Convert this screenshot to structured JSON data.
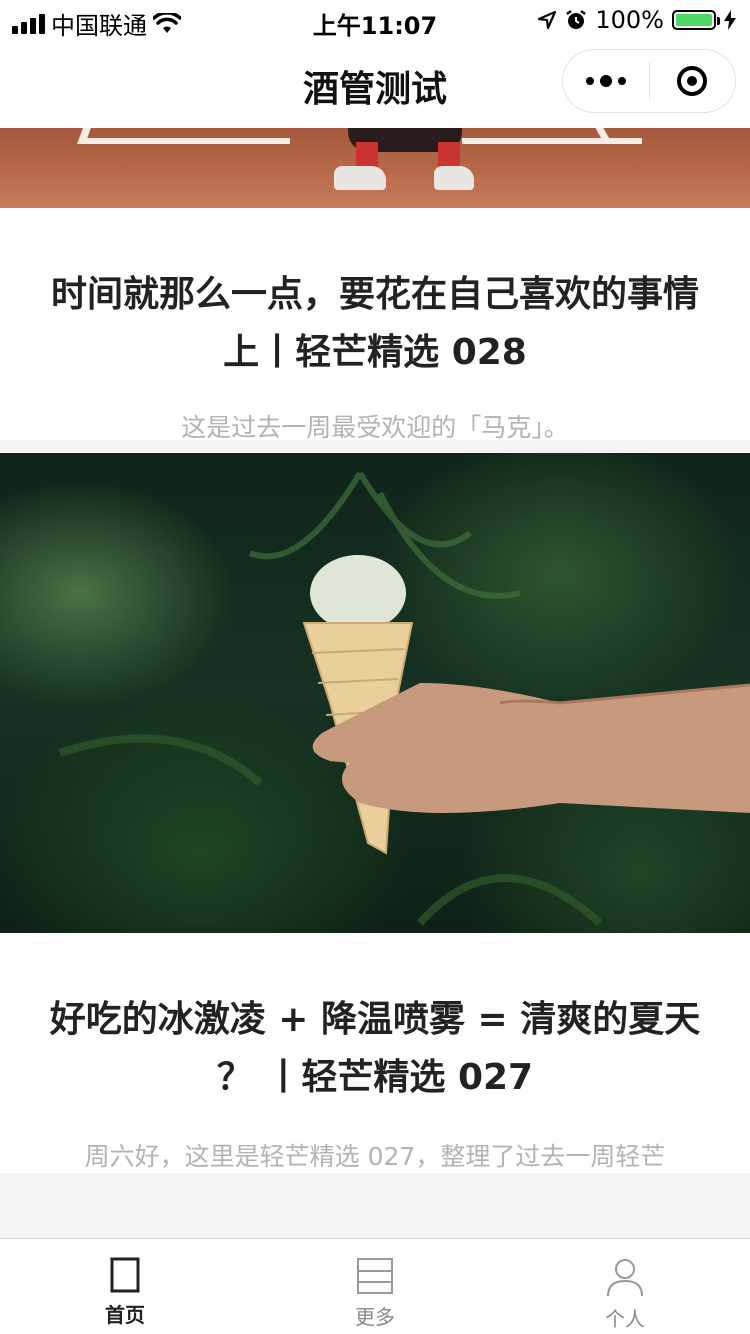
{
  "status_bar": {
    "carrier": "中国联通",
    "time": "上午11:07",
    "battery": "100%",
    "battery_level": 1.0
  },
  "nav": {
    "title": "酒管测试",
    "menu_icon": "more-dots-icon",
    "close_icon": "target-icon"
  },
  "feed": {
    "articles": [
      {
        "title": "时间就那么一点，要花在自己喜欢的事情上丨轻芒精选 028",
        "desc": "这是过去一周最受欢迎的「马克」。",
        "image": "baseball-field-photo"
      },
      {
        "title": "好吃的冰激凌 + 降温喷雾 = 清爽的夏天 ？ 丨轻芒精选 027",
        "desc": "周六好，这里是轻芒精选 027，整理了过去一周轻芒",
        "image": "ice-cream-cone-photo"
      }
    ]
  },
  "tabbar": {
    "tabs": [
      {
        "label": "首页",
        "icon": "home-square-icon",
        "active": true
      },
      {
        "label": "更多",
        "icon": "list-icon",
        "active": false
      },
      {
        "label": "个人",
        "icon": "person-icon",
        "active": false
      }
    ]
  },
  "colors": {
    "battery_green": "#4cd964",
    "desc_gray": "#b3b3b3",
    "tab_inactive": "#888888"
  }
}
